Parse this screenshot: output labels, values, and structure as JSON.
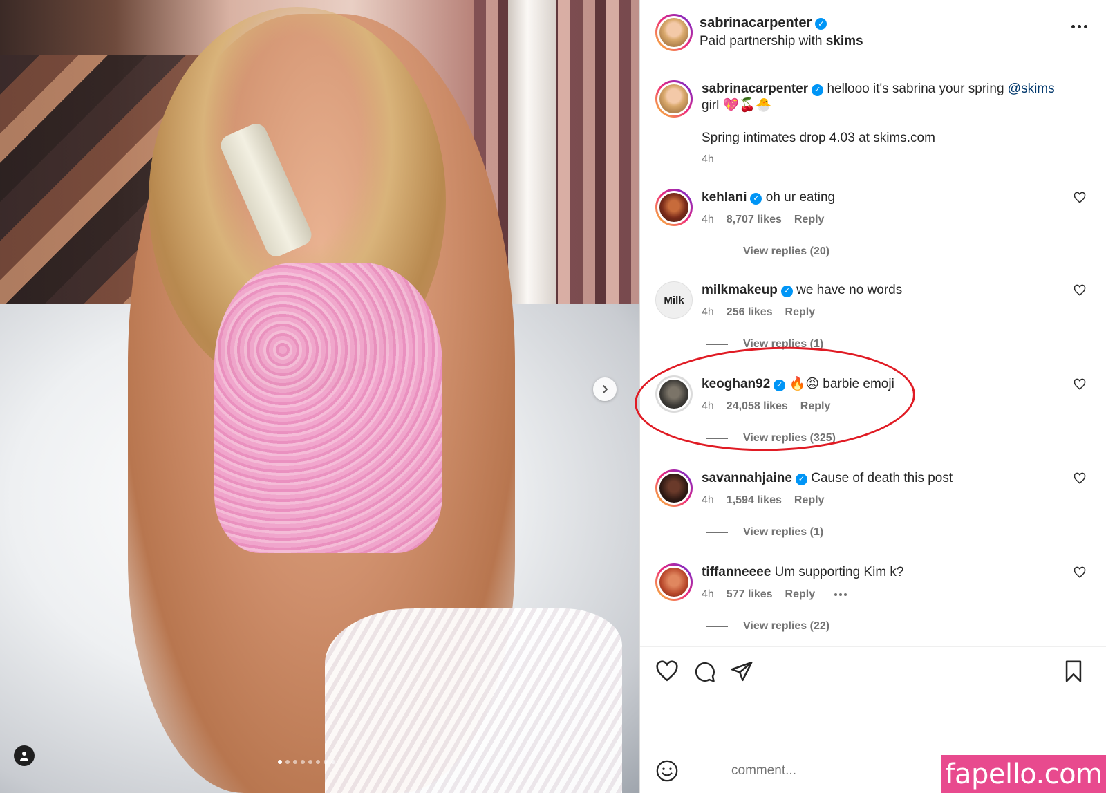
{
  "post": {
    "username": "sabrinacarpenter",
    "partnership_prefix": "Paid partnership with",
    "partner": "skims"
  },
  "caption": {
    "username": "sabrinacarpenter",
    "text": "hellooo it's sabrina your spring",
    "mention": "@skims",
    "text_line2": "girl 💖🍒🐣",
    "body": "Spring intimates drop 4.03 at skims.com",
    "time": "4h"
  },
  "comments": [
    {
      "username": "kehlani",
      "text": "oh ur eating",
      "time": "4h",
      "likes": "8,707 likes",
      "reply": "Reply",
      "replies": "View replies (20)"
    },
    {
      "username": "milkmakeup",
      "text": "we have no words",
      "time": "4h",
      "likes": "256 likes",
      "reply": "Reply",
      "replies": "View replies (1)",
      "avatar_text": "Milk"
    },
    {
      "username": "keoghan92",
      "text": "🔥😡 barbie emoji",
      "time": "4h",
      "likes": "24,058 likes",
      "reply": "Reply",
      "replies": "View replies (325)"
    },
    {
      "username": "savannahjaine",
      "text": "Cause of death this post",
      "time": "4h",
      "likes": "1,594 likes",
      "reply": "Reply",
      "replies": "View replies (1)"
    },
    {
      "username": "tiffanneeee",
      "text": "Um supporting Kim k?",
      "time": "4h",
      "likes": "577 likes",
      "reply": "Reply",
      "replies": "View replies (22)"
    }
  ],
  "add_comment": {
    "placeholder": "comment..."
  },
  "carousel": {
    "count": 8,
    "active_index": 0
  },
  "watermark": "fapello.com",
  "colors": {
    "verified": "#0095f6",
    "highlight": "#e01b24",
    "watermark_bg": "#e84a8e",
    "mention": "#00376b"
  },
  "icons": [
    "ellipsis-icon",
    "heart-icon",
    "comment-icon",
    "share-icon",
    "bookmark-icon",
    "emoji-icon",
    "chevron-right-icon",
    "user-tag-icon",
    "verified-badge-icon"
  ]
}
